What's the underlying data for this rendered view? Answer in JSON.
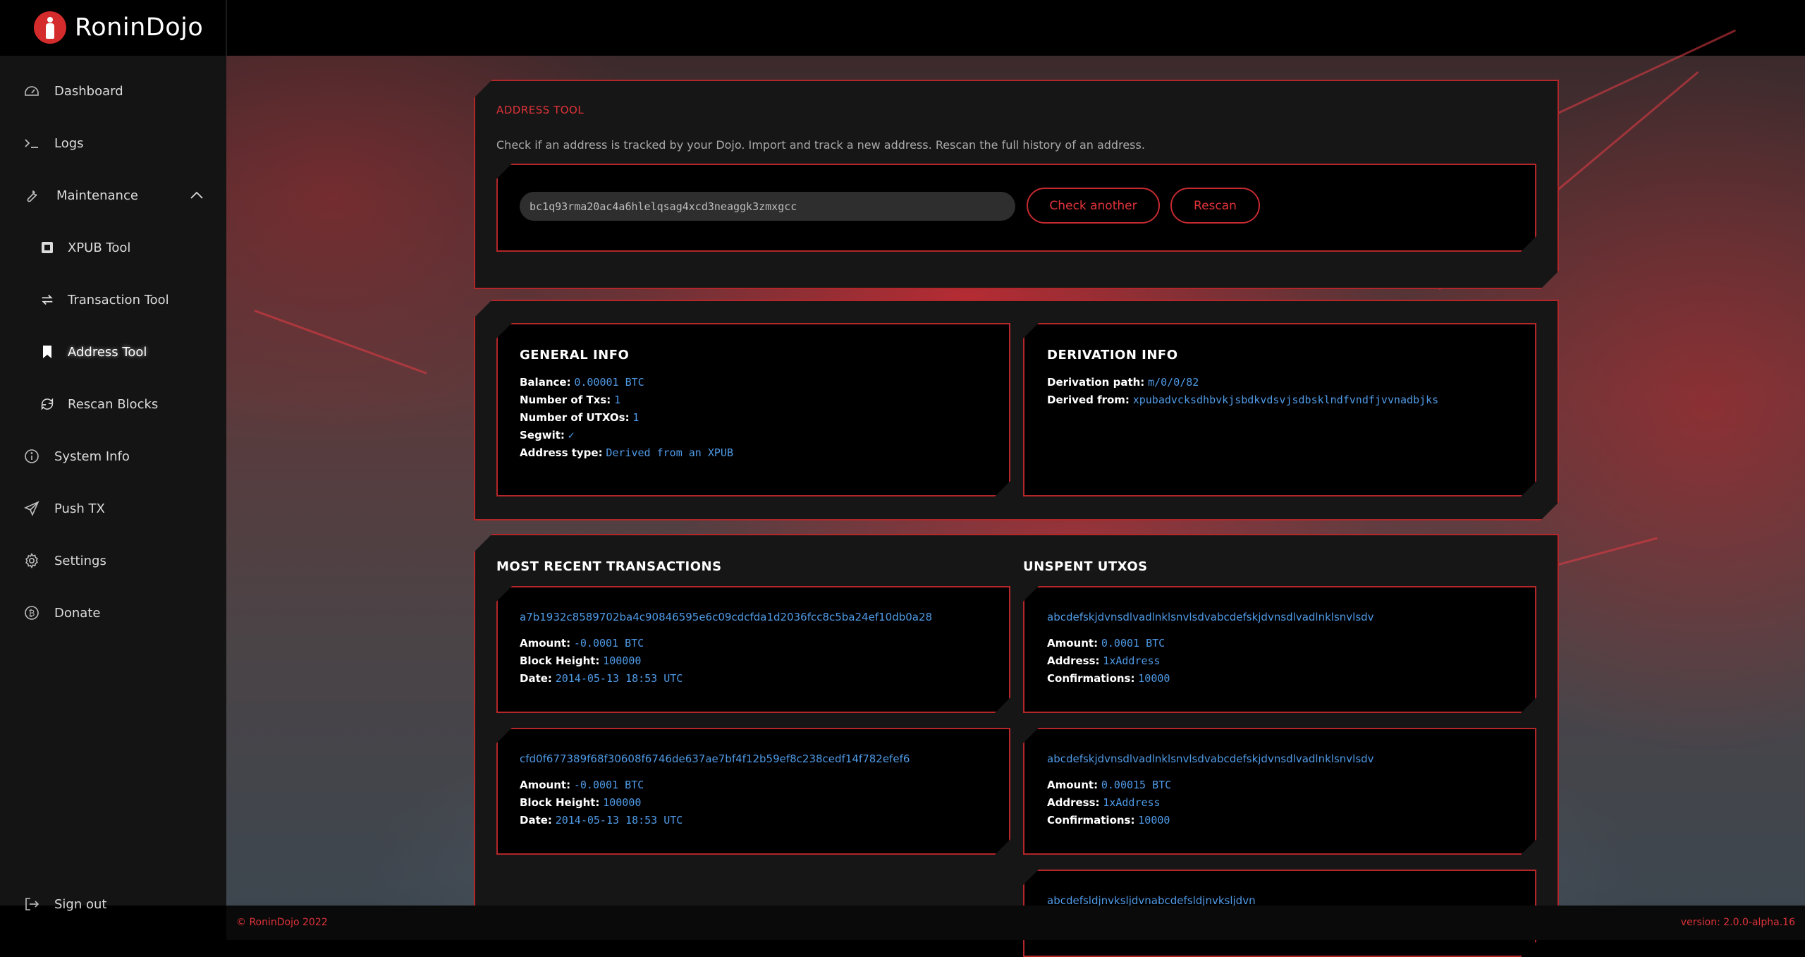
{
  "app": {
    "name": "RoninDojo"
  },
  "sidebar": {
    "items": [
      {
        "label": "Dashboard",
        "icon": "dashboard-icon"
      },
      {
        "label": "Logs",
        "icon": "terminal-icon"
      },
      {
        "label": "Maintenance",
        "icon": "wrench-icon",
        "expanded": true
      },
      {
        "label": "XPUB Tool",
        "icon": "xpub-icon"
      },
      {
        "label": "Transaction Tool",
        "icon": "swap-icon"
      },
      {
        "label": "Address Tool",
        "icon": "bookmark-icon",
        "active": true
      },
      {
        "label": "Rescan Blocks",
        "icon": "rescan-icon"
      },
      {
        "label": "System Info",
        "icon": "info-icon"
      },
      {
        "label": "Push TX",
        "icon": "send-icon"
      },
      {
        "label": "Settings",
        "icon": "gear-icon"
      },
      {
        "label": "Donate",
        "icon": "bitcoin-icon"
      }
    ],
    "signout": "Sign out"
  },
  "address_tool": {
    "title": "ADDRESS TOOL",
    "description": "Check if an address is tracked by your Dojo. Import and track a new address. Rescan the full history of an address.",
    "input_value": "bc1q93rma20ac4a6hlelqsag4xcd3neaggk3zmxgcc",
    "check_label": "Check another",
    "rescan_label": "Rescan"
  },
  "general_info": {
    "title": "GENERAL INFO",
    "balance_label": "Balance:",
    "balance": "0.00001 BTC",
    "txs_label": "Number of Txs:",
    "txs": "1",
    "utxos_label": "Number of UTXOs:",
    "utxos": "1",
    "segwit_label": "Segwit:",
    "segwit": "✓",
    "type_label": "Address type:",
    "type": "Derived from an XPUB"
  },
  "derivation_info": {
    "title": "DERIVATION INFO",
    "path_label": "Derivation path:",
    "path": "m/0/0/82",
    "from_label": "Derived from:",
    "from": "xpubadvcksdhbvkjsbdkvdsvjsdbsklndfvndfjvvnadbjks"
  },
  "transactions": {
    "title": "MOST RECENT TRANSACTIONS",
    "amount_label": "Amount:",
    "height_label": "Block Height:",
    "date_label": "Date:",
    "items": [
      {
        "txid": "a7b1932c8589702ba4c90846595e6c09cdcfda1d2036fcc8c5ba24ef10db0a28",
        "amount": "-0.0001 BTC",
        "height": "100000",
        "date": "2014-05-13 18:53 UTC"
      },
      {
        "txid": "cfd0f677389f68f30608f6746de637ae7bf4f12b59ef8c238cedf14f782efef6",
        "amount": "-0.0001 BTC",
        "height": "100000",
        "date": "2014-05-13 18:53 UTC"
      }
    ]
  },
  "utxos": {
    "title": "UNSPENT UTXOS",
    "amount_label": "Amount:",
    "address_label": "Address:",
    "conf_label": "Confirmations:",
    "items": [
      {
        "id": "abcdefskjdvnsdlvadlnklsnvlsdvabcdefskjdvnsdlvadlnklsnvlsdv",
        "amount": "0.0001 BTC",
        "address": "1xAddress",
        "confirmations": "10000"
      },
      {
        "id": "abcdefskjdvnsdlvadlnklsnvlsdvabcdefskjdvnsdlvadlnklsnvlsdv",
        "amount": "0.00015 BTC",
        "address": "1xAddress",
        "confirmations": "10000"
      },
      {
        "id": "abcdefsldjnvksljdvnabcdefsldjnvksljdvn"
      }
    ]
  },
  "footer": {
    "copyright": "© RoninDojo 2022",
    "version": "version: 2.0.0-alpha.16"
  },
  "colors": {
    "accent": "#e0333a",
    "border": "#b3262a",
    "value": "#4f9ae6",
    "sidebar": "#141414"
  }
}
